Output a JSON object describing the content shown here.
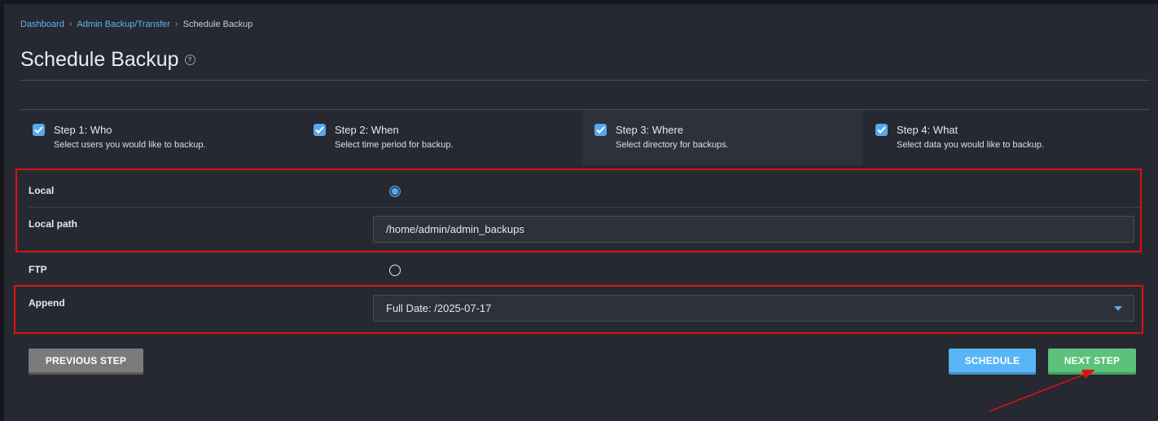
{
  "breadcrumb": {
    "items": [
      "Dashboard",
      "Admin Backup/Transfer",
      "Schedule Backup"
    ]
  },
  "page": {
    "title": "Schedule Backup"
  },
  "steps": [
    {
      "title": "Step 1: Who",
      "subtitle": "Select users you would like to backup.",
      "checked": true
    },
    {
      "title": "Step 2: When",
      "subtitle": "Select time period for backup.",
      "checked": true
    },
    {
      "title": "Step 3: Where",
      "subtitle": "Select directory for backups.",
      "checked": true,
      "active": true
    },
    {
      "title": "Step 4: What",
      "subtitle": "Select data you would like to backup.",
      "checked": true
    }
  ],
  "form": {
    "local_label": "Local",
    "local_selected": true,
    "local_path_label": "Local path",
    "local_path_value": "/home/admin/admin_backups",
    "ftp_label": "FTP",
    "ftp_selected": false,
    "append_label": "Append",
    "append_value": "Full Date: /2025-07-17"
  },
  "buttons": {
    "previous": "PREVIOUS STEP",
    "schedule": "SCHEDULE",
    "next": "NEXT STEP"
  },
  "colors": {
    "accent": "#5aa8ec",
    "annotation_red": "#e01010",
    "next_green": "#5cc17a"
  }
}
